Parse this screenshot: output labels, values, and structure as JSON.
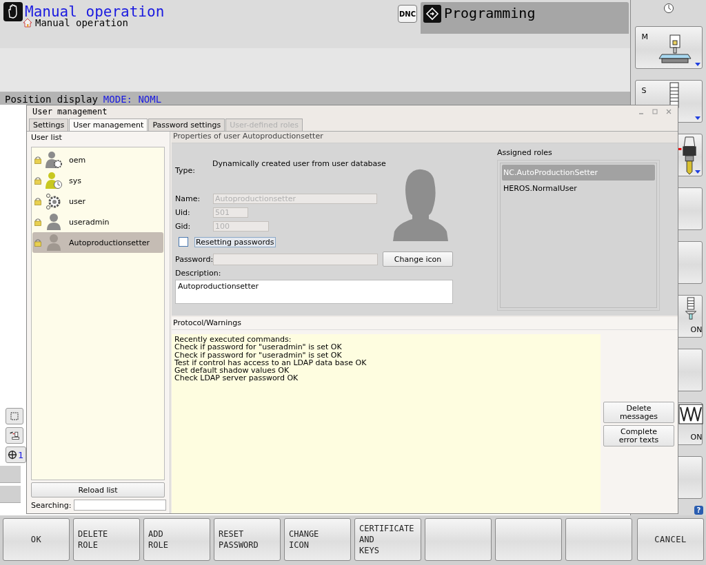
{
  "header": {
    "mode_title": "Manual operation",
    "sub_mode": "Manual operation",
    "dnc": "DNC",
    "program_mode": "Programming",
    "position_label": "Position display",
    "position_mode": "MODE: NOML"
  },
  "side_softkeys": [
    {
      "kind": "clock"
    },
    {
      "kind": "machine",
      "label": "M"
    },
    {
      "kind": "spindle",
      "label": "S"
    },
    {
      "kind": "tool"
    },
    {
      "kind": "blank"
    },
    {
      "kind": "blank"
    },
    {
      "kind": "coolant",
      "label": "ON"
    },
    {
      "kind": "blank"
    },
    {
      "kind": "vibration",
      "label": "ON"
    },
    {
      "kind": "blank"
    }
  ],
  "help": "?",
  "left_icons": [
    {
      "kind": "frame"
    },
    {
      "kind": "machine"
    },
    {
      "kind": "datum",
      "label": "1"
    }
  ],
  "dialog": {
    "title": "User management",
    "tabs": [
      {
        "label": "Settings",
        "selected": false,
        "disabled": false
      },
      {
        "label": "User management",
        "selected": true,
        "disabled": false
      },
      {
        "label": "Password settings",
        "selected": false,
        "disabled": false
      },
      {
        "label": "User-defined roles",
        "selected": false,
        "disabled": true
      }
    ],
    "user_list": {
      "label": "User list",
      "users": [
        {
          "name": "oem",
          "kind": "gear-user",
          "selected": false
        },
        {
          "name": "sys",
          "kind": "sys-user",
          "selected": false
        },
        {
          "name": "user",
          "kind": "gear",
          "selected": false
        },
        {
          "name": "useradmin",
          "kind": "person",
          "selected": false
        },
        {
          "name": "Autoproductionsetter",
          "kind": "person",
          "selected": true
        }
      ],
      "reload": "Reload list",
      "search_label": "Searching:"
    },
    "properties": {
      "heading": "Properties of user Autoproductionsetter",
      "type_label": "Type:",
      "type_value": "Dynamically created user from user database",
      "name_label": "Name:",
      "name_value": "Autoproductionsetter",
      "uid_label": "Uid:",
      "uid_value": "501",
      "gid_label": "Gid:",
      "gid_value": "100",
      "reset": {
        "label": "Resetting passwords",
        "checked": false
      },
      "password_label": "Password:",
      "change_icon": "Change icon",
      "description_label": "Description:",
      "description_value": "Autoproductionsetter",
      "roles_label": "Assigned roles",
      "roles": [
        {
          "name": "NC.AutoProductionSetter",
          "selected": true
        },
        {
          "name": "HEROS.NormalUser",
          "selected": false
        }
      ]
    },
    "protocol": {
      "label": "Protocol/Warnings",
      "lines": [
        "Recently executed commands:",
        "Check if password for \"useradmin\" is set OK",
        "Check if password for \"useradmin\" is set OK",
        "Test if control has access to an LDAP data base OK",
        "Get default shadow values OK",
        "Check LDAP server password OK"
      ],
      "buttons": [
        [
          "Delete",
          "messages"
        ],
        [
          "Complete",
          "error texts"
        ]
      ]
    }
  },
  "softkeys": [
    {
      "kind": "label",
      "lines": [
        "OK"
      ]
    },
    {
      "kind": "label",
      "lines": [
        "DELETE",
        "ROLE"
      ]
    },
    {
      "kind": "label",
      "lines": [
        "ADD",
        "ROLE"
      ]
    },
    {
      "kind": "label",
      "lines": [
        "RESET",
        "PASSWORD"
      ]
    },
    {
      "kind": "label",
      "lines": [
        "CHANGE",
        "ICON"
      ]
    },
    {
      "kind": "label",
      "lines": [
        "CERTIFICATE",
        "AND",
        "KEYS"
      ]
    },
    {
      "kind": "blank"
    },
    {
      "kind": "blank"
    },
    {
      "kind": "blank"
    },
    {
      "kind": "label",
      "lines": [
        "CANCEL"
      ]
    }
  ]
}
